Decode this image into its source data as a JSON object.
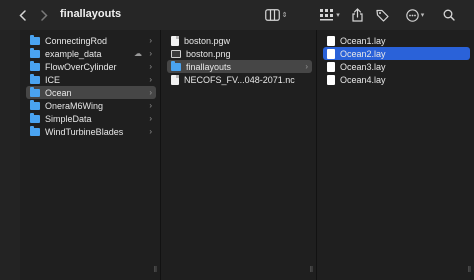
{
  "toolbar": {
    "title": "finallayouts",
    "back_icon": "chevron-left-icon",
    "forward_icon": "chevron-right-icon",
    "view_icon": "column-view-icon",
    "group_icon": "grid-group-icon",
    "share_icon": "share-icon",
    "tag_icon": "tag-icon",
    "more_icon": "ellipsis-circle-icon",
    "search_icon": "search-icon"
  },
  "columns": [
    {
      "items": [
        {
          "label": "ConnectingRod",
          "icon": "folder-icon",
          "selected": "none",
          "chevron": true
        },
        {
          "label": "example_data",
          "icon": "folder-icon",
          "selected": "none",
          "chevron": true,
          "cloud": true
        },
        {
          "label": "FlowOverCylinder",
          "icon": "folder-icon",
          "selected": "none",
          "chevron": true
        },
        {
          "label": "ICE",
          "icon": "folder-icon",
          "selected": "none",
          "chevron": true
        },
        {
          "label": "Ocean",
          "icon": "folder-icon",
          "selected": "gray",
          "chevron": true
        },
        {
          "label": "OneraM6Wing",
          "icon": "folder-icon",
          "selected": "none",
          "chevron": true
        },
        {
          "label": "SimpleData",
          "icon": "folder-icon",
          "selected": "none",
          "chevron": true
        },
        {
          "label": "WindTurbineBlades",
          "icon": "folder-icon",
          "selected": "none",
          "chevron": true
        }
      ]
    },
    {
      "items": [
        {
          "label": "boston.pgw",
          "icon": "file-icon",
          "selected": "none"
        },
        {
          "label": "boston.png",
          "icon": "image-icon",
          "selected": "none"
        },
        {
          "label": "finallayouts",
          "icon": "folder-icon",
          "selected": "gray",
          "chevron": true
        },
        {
          "label": "NECOFS_FV...048-2071.nc",
          "icon": "file-icon",
          "selected": "none"
        }
      ]
    },
    {
      "items": [
        {
          "label": "Ocean1.lay",
          "icon": "lay-file-icon",
          "selected": "none"
        },
        {
          "label": "Ocean2.lay",
          "icon": "lay-file-icon",
          "selected": "blue"
        },
        {
          "label": "Ocean3.lay",
          "icon": "lay-file-icon",
          "selected": "none"
        },
        {
          "label": "Ocean4.lay",
          "icon": "lay-file-icon",
          "selected": "none"
        }
      ]
    }
  ],
  "colors": {
    "selection_blue": "#2a62d9",
    "selection_gray": "#464646",
    "folder_blue": "#4aa3f0"
  }
}
